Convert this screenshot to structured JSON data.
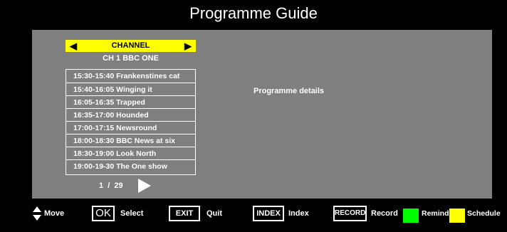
{
  "title": "Programme Guide",
  "channel_selector": {
    "label": "CHANNEL",
    "left_arrow": "◀",
    "right_arrow": "▶"
  },
  "channel_name": "CH 1 BBC ONE",
  "programmes": [
    "15:30-15:40 Frankenstines cat",
    "15:40-16:05 Winging it",
    "16:05-16:35 Trapped",
    "16:35-17:00 Hounded",
    "17:00-17:15 Newsround",
    "18:00-18:30 BBC News at six",
    "18:30-19:00 Look North",
    "19:00-19-30 The One show"
  ],
  "pager": "1  /  29",
  "details_label": "Programme details",
  "footer": {
    "move": "Move",
    "ok_key": "OK",
    "select": "Select",
    "exit_key": "EXIT",
    "quit": "Quit",
    "index_key": "INDEX",
    "index": "Index",
    "record_key": "RECORD",
    "record": "Record",
    "remind": "Remind",
    "schedule": "Schedule"
  },
  "colors": {
    "panel": "#7f7f7f",
    "header": "#ffff00",
    "remind": "#00ff00",
    "schedule": "#ffff00"
  }
}
